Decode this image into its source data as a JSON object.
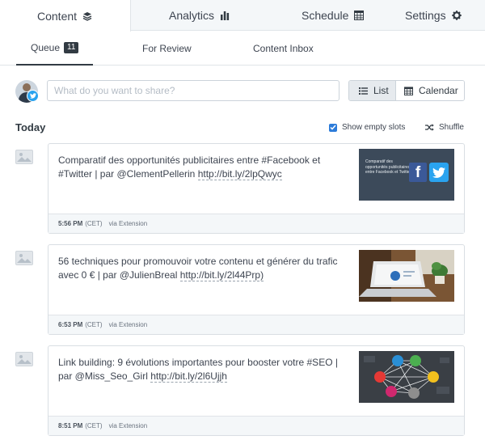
{
  "tabs": [
    {
      "label": "Content",
      "icon": "stack-icon"
    },
    {
      "label": "Analytics",
      "icon": "bar-chart-icon"
    },
    {
      "label": "Schedule",
      "icon": "calendar-grid-icon"
    },
    {
      "label": "Settings",
      "icon": "gear-icon"
    }
  ],
  "subtabs": {
    "queue": "Queue",
    "queue_count": "11",
    "review": "For Review",
    "inbox": "Content Inbox"
  },
  "composer": {
    "placeholder": "What do you want to share?"
  },
  "view": {
    "list": "List",
    "calendar": "Calendar"
  },
  "day": {
    "title": "Today",
    "show_empty": "Show empty slots",
    "show_empty_checked": true,
    "shuffle": "Shuffle"
  },
  "posts": [
    {
      "text_main": "Comparatif des opportunités publicitaires entre #Facebook et #Twitter | par @ClementPellerin ",
      "link": "http://bit.ly/2lpQwyc",
      "time": "5:56 PM",
      "tz": "(CET)",
      "via": "via Extension",
      "thumb_caption": "Comparatif des opportunités publicitaires entre Facebook et Twitter"
    },
    {
      "text_main": "56 techniques pour promouvoir votre contenu et générer du trafic avec 0 € | par @JulienBreal ",
      "link": "http://bit.ly/2l44Prp)",
      "time": "6:53 PM",
      "tz": "(CET)",
      "via": "via Extension"
    },
    {
      "text_main": "Link building: 9 évolutions importantes pour booster votre #SEO | par @Miss_Seo_Girl ",
      "link": "http://bit.ly/2l6Ujjh",
      "time": "8:51 PM",
      "tz": "(CET)",
      "via": "via Extension"
    }
  ],
  "colors": {
    "accent": "#2c7bd9",
    "twitter": "#2aa3ef",
    "facebook": "#3b5998",
    "dark": "#323b43"
  }
}
